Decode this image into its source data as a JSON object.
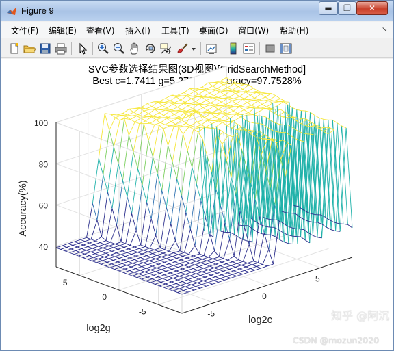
{
  "window": {
    "title": "Figure 9",
    "min_label": "▬",
    "max_label": "❐",
    "close_label": "✕"
  },
  "menubar": {
    "items": [
      {
        "label": "文件(F)"
      },
      {
        "label": "编辑(E)"
      },
      {
        "label": "查看(V)"
      },
      {
        "label": "插入(I)"
      },
      {
        "label": "工具(T)"
      },
      {
        "label": "桌面(D)"
      },
      {
        "label": "窗口(W)"
      },
      {
        "label": "帮助(H)"
      }
    ],
    "dock_arrow": "↘"
  },
  "toolbar": {
    "icons": [
      "new-figure-icon",
      "open-file-icon",
      "save-icon",
      "print-icon",
      "edit-plot-icon",
      "zoom-in-icon",
      "zoom-out-icon",
      "pan-icon",
      "rotate-3d-icon",
      "data-cursor-icon",
      "brush-icon",
      "brush-dropdown-icon",
      "link-plot-icon",
      "colorbar-icon",
      "legend-icon",
      "hide-plot-tools-icon",
      "show-plot-tools-icon"
    ]
  },
  "plot": {
    "title_line1": "SVC参数选择结果图(3D视图)[GridSearchMethod]",
    "title_line2": "Best c=1.7411 g=5.278 CVAccuracy=97.7528%"
  },
  "chart_data": {
    "type": "surface",
    "title": "SVC参数选择结果图(3D视图)[GridSearchMethod]",
    "subtitle": "Best c=1.7411 g=5.278 CVAccuracy=97.7528%",
    "xlabel": "log2c",
    "ylabel": "log2g",
    "zlabel": "Accuracy(%)",
    "xlim": [
      -8,
      8
    ],
    "ylim": [
      -8,
      8
    ],
    "zlim": [
      30,
      100
    ],
    "x_ticks": [
      "-5",
      "0",
      "5"
    ],
    "y_ticks": [
      "-5",
      "0",
      "5"
    ],
    "z_ticks": [
      "40",
      "60",
      "80",
      "100"
    ],
    "grid": true,
    "colormap": [
      "#2b2e8c",
      "#2d6fb0",
      "#20b2aa",
      "#7ccf5f",
      "#f6e73a"
    ],
    "low_plateau_value": 39.3,
    "high_plateau_value": 97.7,
    "best": {
      "log2c": 0.8,
      "log2g": 2.4,
      "accuracy": 97.7528
    }
  },
  "watermark": {
    "zhihu": "知乎 @阿沉",
    "csdn": "CSDN @mozun2020"
  }
}
